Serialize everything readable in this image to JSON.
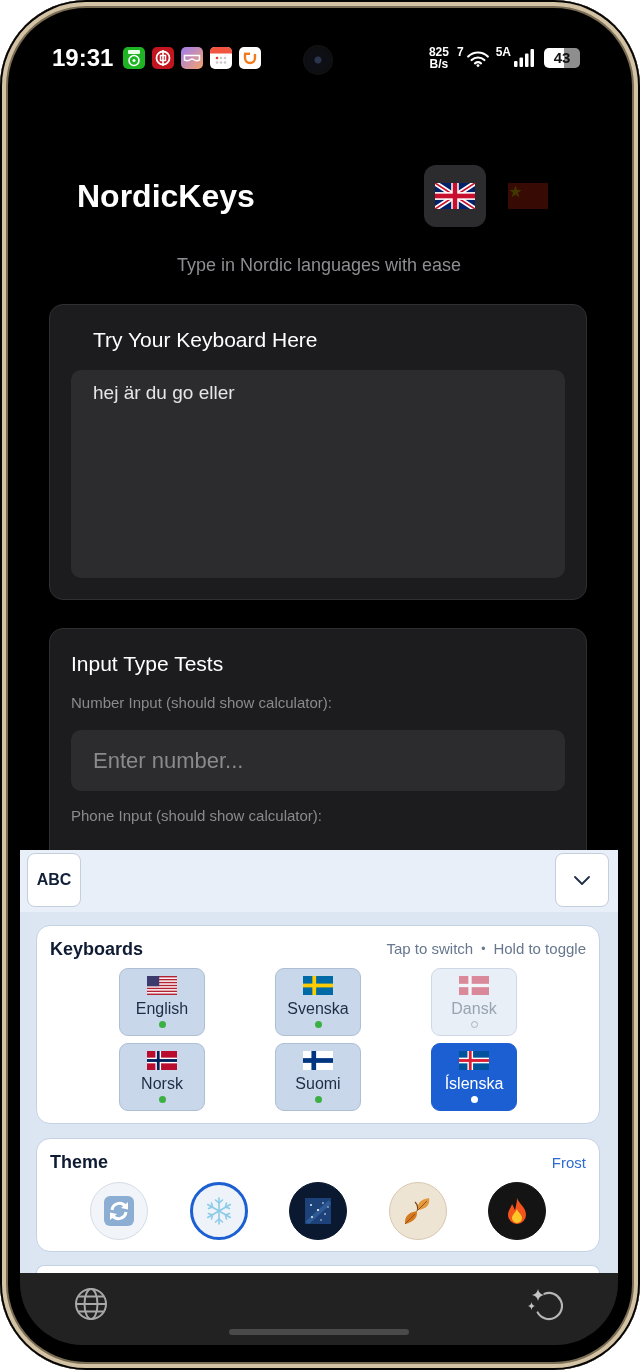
{
  "status_bar": {
    "time": "19:31",
    "net_speed": "825",
    "net_unit": "B/s",
    "wifi_label": "7",
    "signal_label": "5A",
    "battery": "43"
  },
  "header": {
    "title": "NordicKeys",
    "languages": [
      {
        "kind": "uk",
        "selected": true
      },
      {
        "kind": "cn",
        "selected": false
      }
    ],
    "subtitle": "Type in Nordic languages with ease"
  },
  "try_card": {
    "title": "Try Your Keyboard Here",
    "value": "hej är du go eller"
  },
  "input_tests": {
    "title": "Input Type Tests",
    "fields": [
      {
        "label": "Number Input (should show calculator):",
        "placeholder": "Enter number..."
      },
      {
        "label": "Phone Input (should show calculator):"
      }
    ]
  },
  "keyboard_panel": {
    "mode_button": "ABC",
    "keyboards": {
      "title": "Keyboards",
      "hint_tap": "Tap to switch",
      "separator": "•",
      "hint_hold": "Hold to toggle",
      "items": [
        {
          "label": "English",
          "kind": "us",
          "enabled": true,
          "selected": false
        },
        {
          "label": "Svenska",
          "kind": "se",
          "enabled": true,
          "selected": false
        },
        {
          "label": "Dansk",
          "kind": "dk",
          "enabled": false,
          "selected": false
        },
        {
          "label": "Norsk",
          "kind": "no",
          "enabled": true,
          "selected": false
        },
        {
          "label": "Suomi",
          "kind": "fi",
          "enabled": true,
          "selected": false
        },
        {
          "label": "Íslenska",
          "kind": "is",
          "enabled": true,
          "selected": true
        }
      ]
    },
    "theme": {
      "title": "Theme",
      "current": "Frost",
      "options": [
        {
          "kind": "auto",
          "selected": false
        },
        {
          "kind": "frost",
          "selected": true
        },
        {
          "kind": "galaxy",
          "selected": false
        },
        {
          "kind": "autumn",
          "selected": false
        },
        {
          "kind": "fire",
          "selected": false
        }
      ]
    }
  }
}
